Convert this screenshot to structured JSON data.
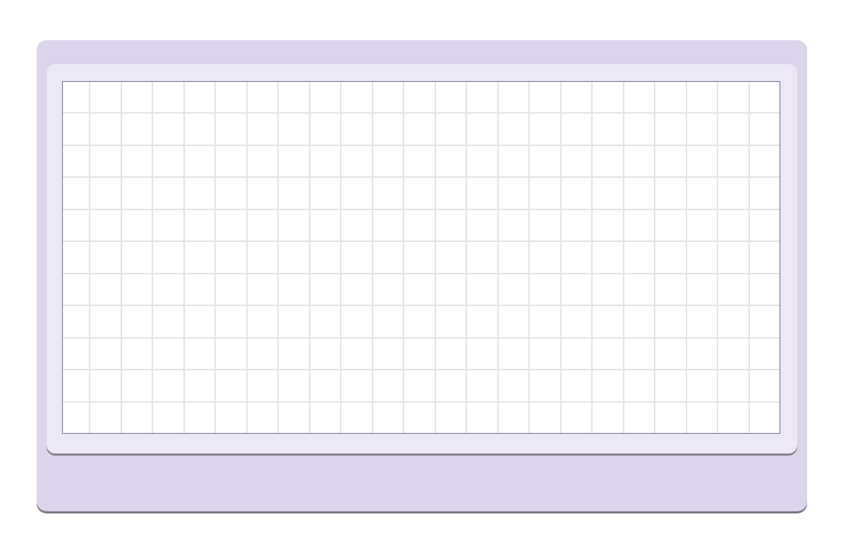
{
  "colors": {
    "outer_panel": "#dcd4ea",
    "inner_panel": "#ece8f8",
    "board_background": "#ffffff",
    "grid_line": "#e4e2e8",
    "board_border": "#6c6c80"
  },
  "board": {
    "columns": 23,
    "rows": 11
  }
}
